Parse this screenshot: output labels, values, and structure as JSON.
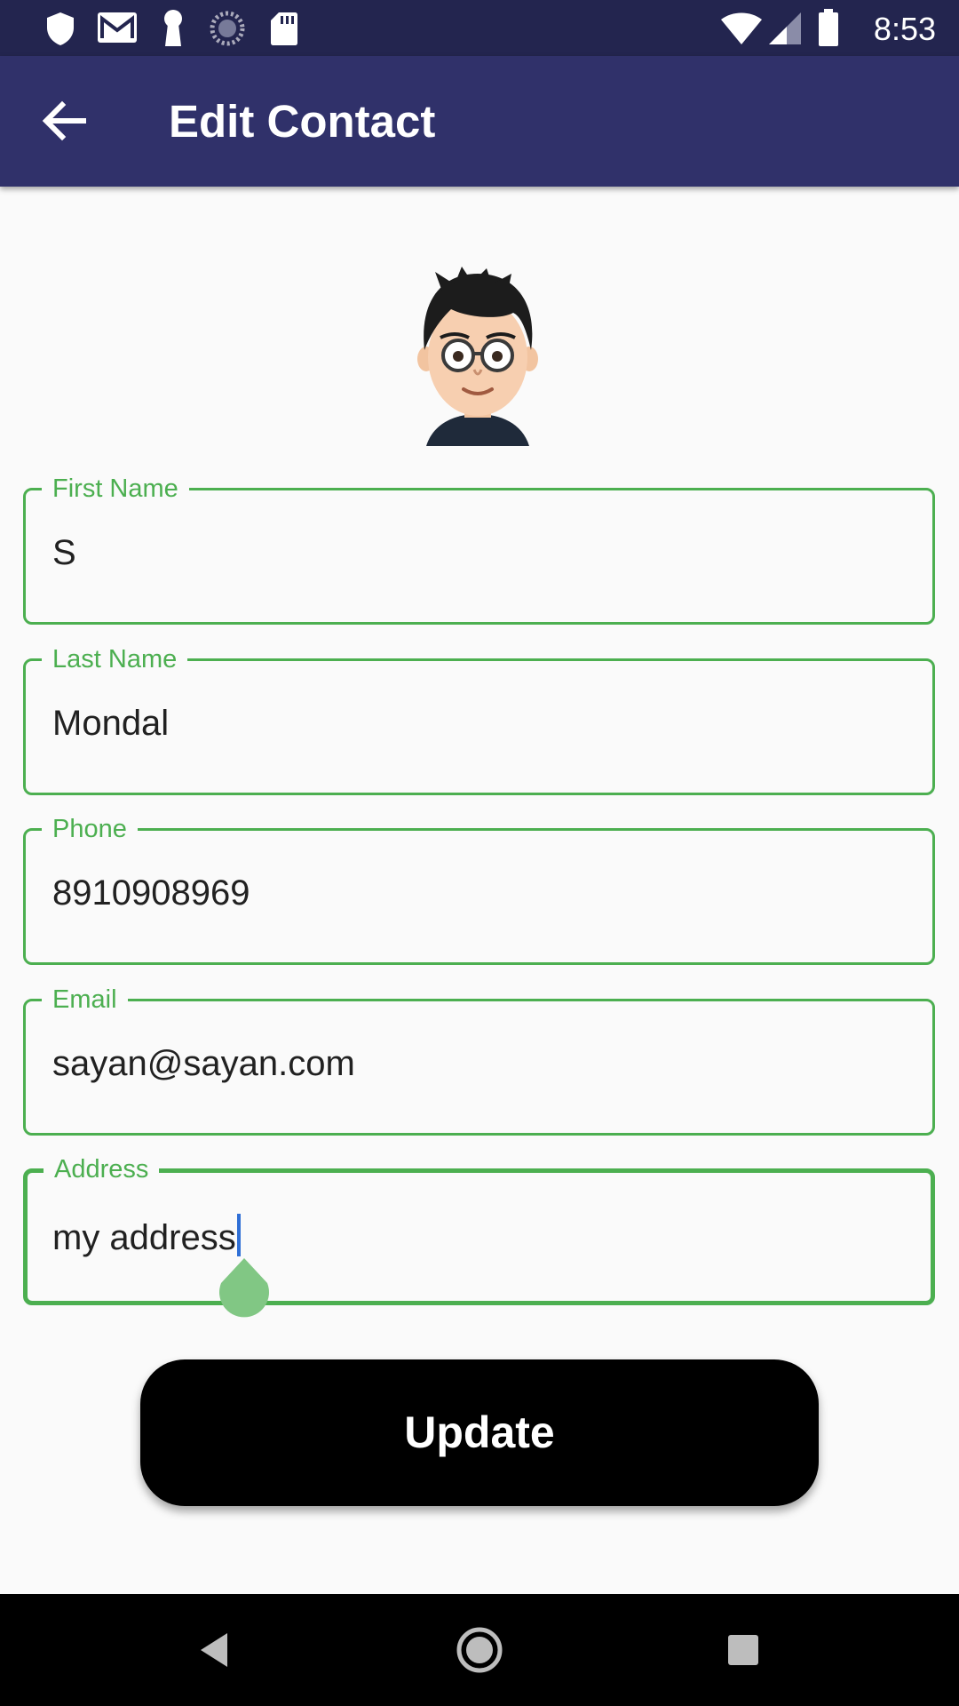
{
  "status_bar": {
    "time": "8:53",
    "left_icons": [
      "shield-icon",
      "gmail-icon",
      "keyhole-icon",
      "sync-icon",
      "sd-card-icon"
    ],
    "right_icons": [
      "wifi-icon",
      "cell-signal-icon",
      "battery-icon"
    ]
  },
  "app_bar": {
    "title": "Edit Contact",
    "back_icon": "arrow-back-icon",
    "color": "#30316a"
  },
  "form": {
    "accent_color": "#4caf50",
    "fields": [
      {
        "label": "First Name",
        "value": "S"
      },
      {
        "label": "Last Name",
        "value": "Mondal"
      },
      {
        "label": "Phone",
        "value": "8910908969"
      },
      {
        "label": "Email",
        "value": "sayan@sayan.com"
      },
      {
        "label": "Address",
        "value": "my address",
        "focused": true
      }
    ]
  },
  "update_button": {
    "label": "Update"
  },
  "nav_bar": {
    "buttons": [
      "back-triangle-icon",
      "home-circle-icon",
      "recents-square-icon"
    ]
  }
}
